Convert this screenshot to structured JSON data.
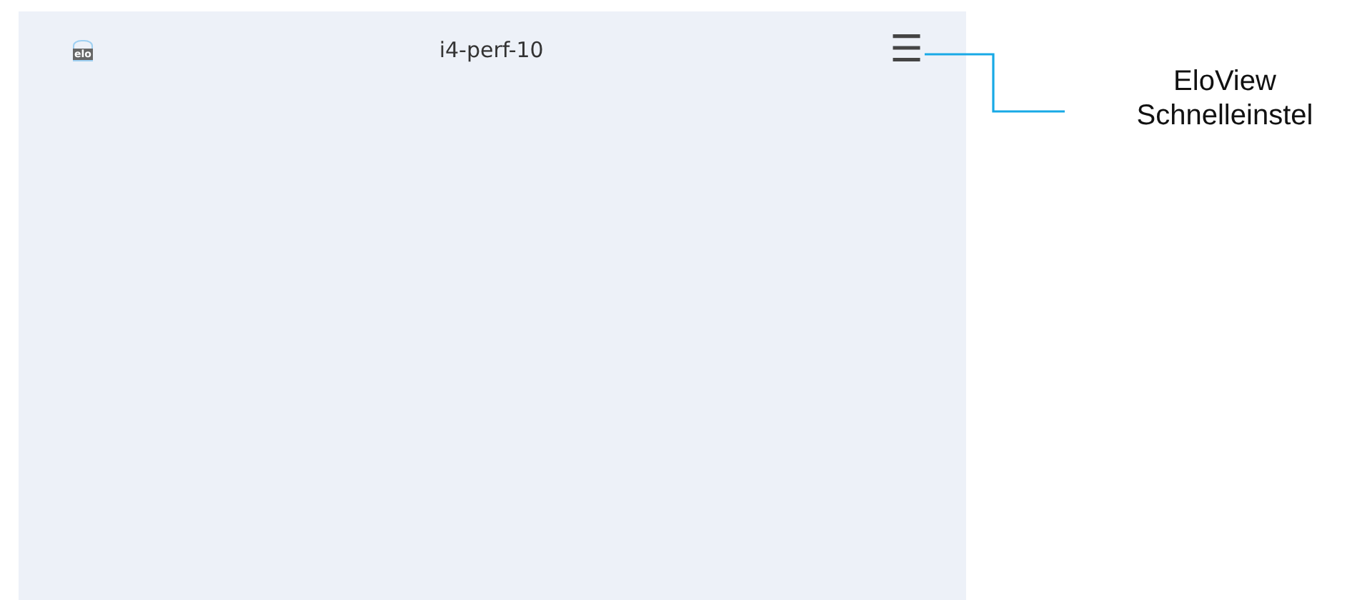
{
  "screen": {
    "logo_text": "elo",
    "title": "i4-perf-10",
    "menu_icon": "☰"
  },
  "callout": {
    "lines": [
      "EloView",
      "Schnelleinstel"
    ]
  }
}
